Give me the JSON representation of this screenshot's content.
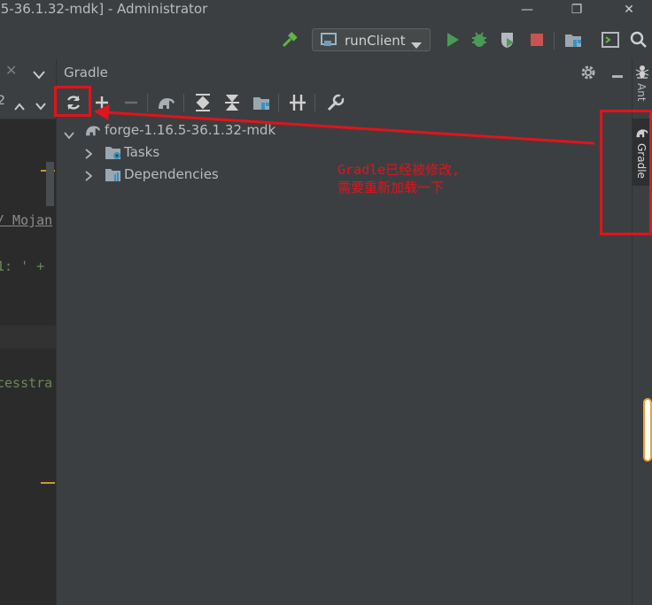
{
  "window": {
    "title": ".5-36.1.32-mdk] - Administrator",
    "minimize_glyph": "—",
    "restore_glyph": "❐",
    "close_glyph": "✕"
  },
  "toolbar": {
    "run_config": "runClient",
    "icons": [
      "hammer-icon",
      "run-config-icon",
      "run-icon",
      "debug-icon",
      "coverage-icon",
      "stop-icon",
      "project-structure-icon",
      "terminal-icon",
      "search-icon"
    ]
  },
  "left_panel": {
    "close_glyph": "✕",
    "line_marker": "2",
    "code_fragments": [
      "/ Mojan",
      "1: ' +",
      "cesstra"
    ]
  },
  "gradle_panel": {
    "title": "Gradle",
    "toolbar_icons": [
      "reload-icon",
      "add-icon",
      "remove-icon",
      "gradle-elephant-icon",
      "expand-all-icon",
      "collapse-all-icon",
      "dependencies-icon",
      "toggle-offline-icon",
      "settings-wrench-icon"
    ],
    "tree": {
      "root": "forge-1.16.5-36.1.32-mdk",
      "children": [
        "Tasks",
        "Dependencies"
      ]
    }
  },
  "right_sidebar": {
    "tabs": [
      "Ant",
      "Gradle"
    ]
  },
  "annotation": {
    "line1": "Gradle已经被修改,",
    "line2": "需要重新加载一下"
  },
  "colors": {
    "accent_red": "#e0141c",
    "run_green": "#499c54",
    "stop_red": "#c75450",
    "marker_orange": "#c99a2e"
  }
}
